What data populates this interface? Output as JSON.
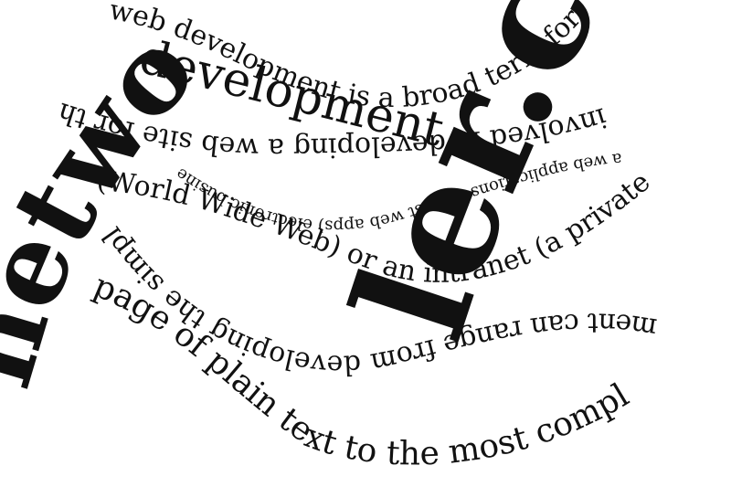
{
  "colors": {
    "background": "#ffffff",
    "ink": "#111111"
  },
  "lines": {
    "l1": "web development is a broad term for the work",
    "l2": "involved in developing a web site for the Internet",
    "l3": "(World Wide Web) or an intranet (a private network",
    "l4": "ment can range from developing the simplest static",
    "l5": "page of plain text to the most complex Web-based",
    "l6": "a web applications (or just web apps) electronic businesses",
    "l7": "development",
    "big_left": "network",
    "big_right": "ler.co"
  }
}
